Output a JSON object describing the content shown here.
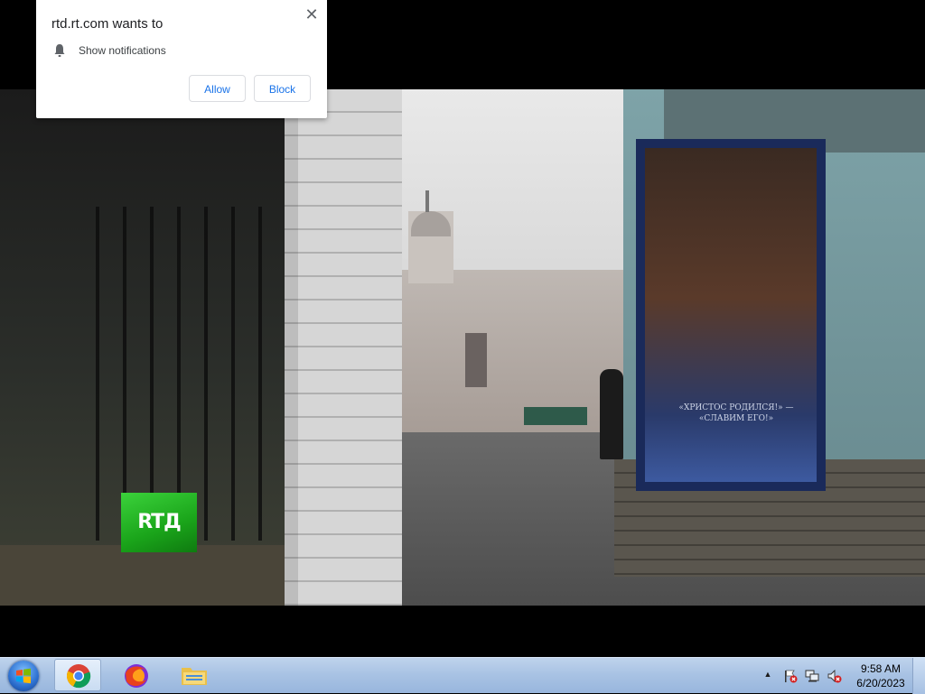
{
  "notification": {
    "site": "rtd.rt.com wants to",
    "permission": "Show notifications",
    "close_glyph": "✕",
    "allow_label": "Allow",
    "block_label": "Block",
    "icon": "bell-icon"
  },
  "video": {
    "channel_logo": "RTД",
    "icon_caption_line1": "«ХРИСТОС РОДИЛСЯ!» —",
    "icon_caption_line2": "«СЛАВИМ ЕГО!»"
  },
  "taskbar": {
    "start_icon": "windows-start-orb-icon",
    "pinned": [
      {
        "name": "chrome",
        "icon": "chrome-icon",
        "active": true
      },
      {
        "name": "firefox",
        "icon": "firefox-icon",
        "active": false
      },
      {
        "name": "file-explorer",
        "icon": "folder-icon",
        "active": false
      }
    ],
    "tray": {
      "overflow_glyph": "▲",
      "icons": [
        "action-center-flag-icon",
        "network-icon",
        "volume-muted-icon"
      ]
    },
    "clock": {
      "time": "9:58 AM",
      "date": "6/20/2023"
    }
  },
  "colors": {
    "taskbar": "#a9c3e4",
    "button_text": "#1a73e8",
    "rt_green": "#22b422"
  }
}
